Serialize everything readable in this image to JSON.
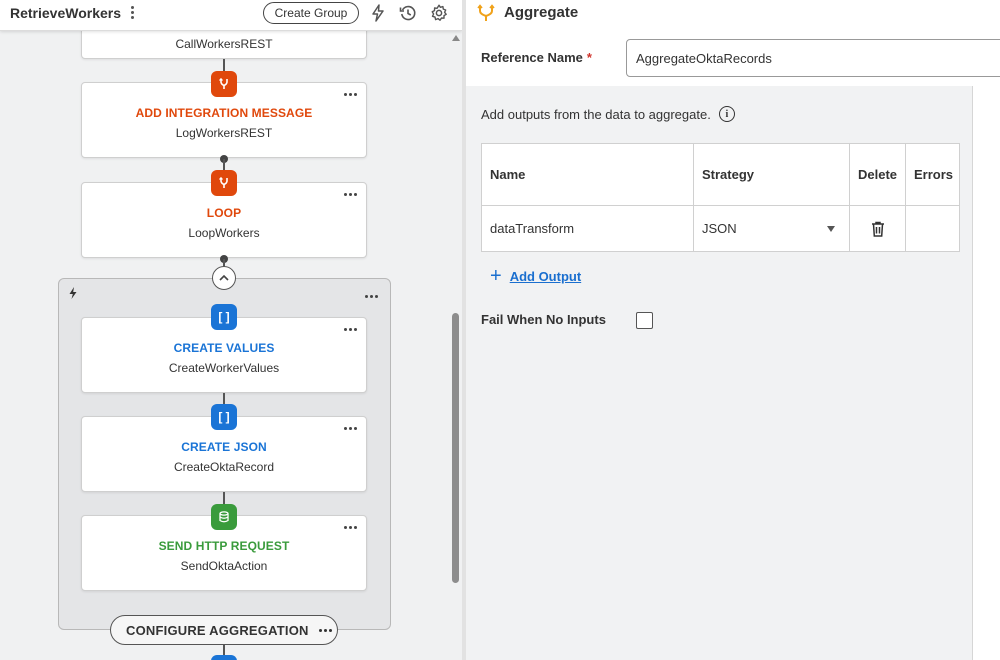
{
  "workflow": {
    "title": "RetrieveWorkers",
    "create_group_label": "Create Group"
  },
  "steps": [
    {
      "type": "",
      "name": "CallWorkersREST"
    },
    {
      "type": "ADD INTEGRATION MESSAGE",
      "name": "LogWorkersREST",
      "color": "#e0480c"
    },
    {
      "type": "LOOP",
      "name": "LoopWorkers",
      "color": "#e0480c"
    },
    {
      "type": "CREATE VALUES",
      "name": "CreateWorkerValues",
      "color": "#1a74d6",
      "icon_text": "[ ]"
    },
    {
      "type": "CREATE JSON",
      "name": "CreateOktaRecord",
      "color": "#1a74d6",
      "icon_text": "[ ]"
    },
    {
      "type": "SEND HTTP REQUEST",
      "name": "SendOktaAction",
      "color": "#3a9b3c"
    }
  ],
  "group": {
    "configure_label": "CONFIGURE AGGREGATION"
  },
  "panel": {
    "title": "Aggregate",
    "reference_name_label": "Reference Name",
    "required_marker": "*",
    "reference_name_value": "AggregateOktaRecords",
    "help_text": "Add outputs from the data to aggregate.",
    "info_icon_text": "i",
    "table": {
      "headers": [
        "Name",
        "Strategy",
        "Delete",
        "Errors"
      ],
      "rows": [
        {
          "name": "dataTransform",
          "strategy": "JSON",
          "errors": ""
        }
      ]
    },
    "add_output_label": "Add Output",
    "fail_when_no_inputs_label": "Fail When No Inputs",
    "fail_when_no_inputs_checked": false
  },
  "icons": {
    "toolbar": [
      "kebab-icon",
      "lightning-icon",
      "history-icon",
      "settings-gear-icon"
    ],
    "panel": "aggregate-icon"
  },
  "colors": {
    "orange": "#e0480c",
    "blue": "#1a74d6",
    "green": "#3a9b3c",
    "link": "#1a6fcf",
    "required": "#d0332b"
  }
}
